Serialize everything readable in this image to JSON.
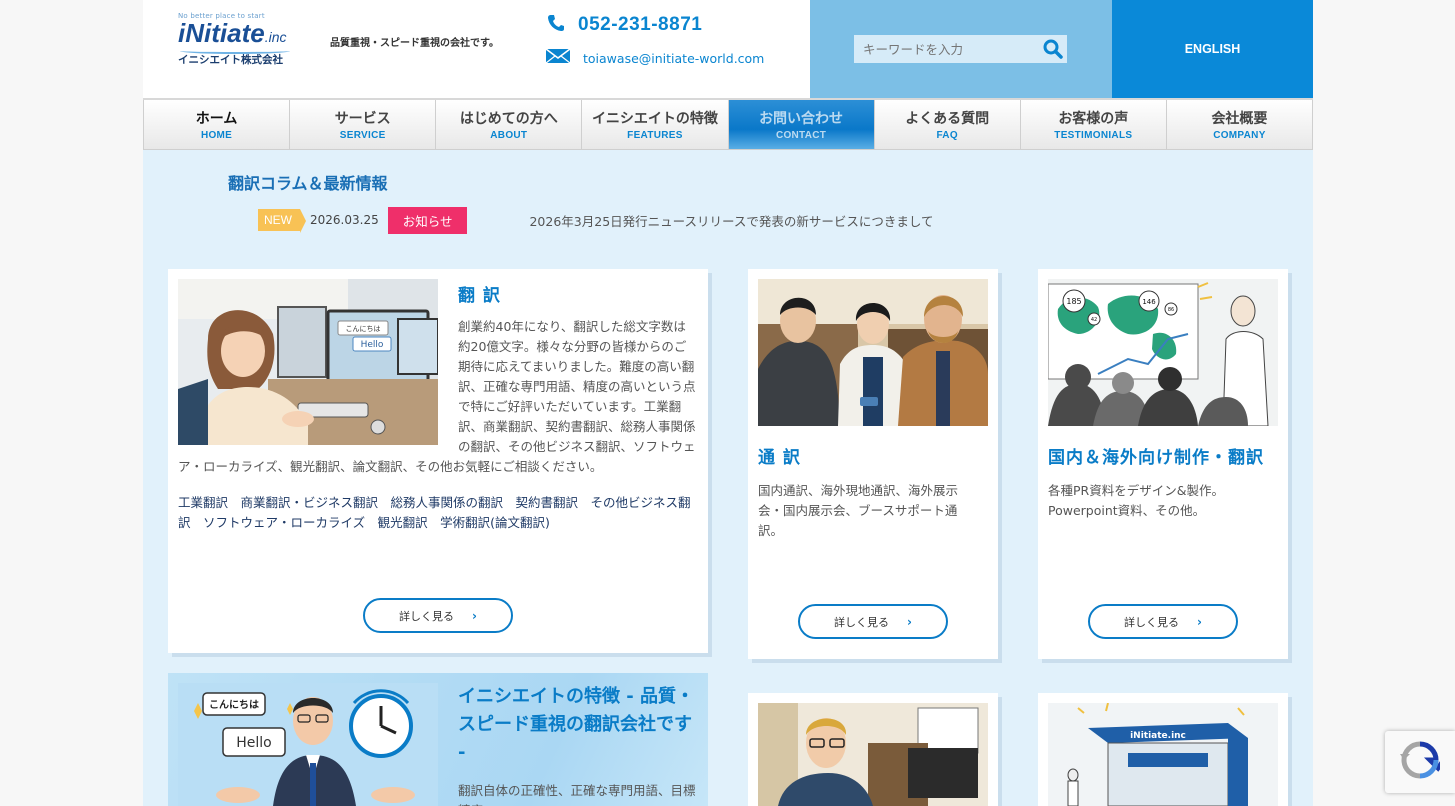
{
  "header": {
    "logo_tagline": "No better place to start",
    "logo_mark": "iNitiate",
    "logo_suffix": ".inc",
    "logo_company": "イニシエイト株式会社",
    "catch": "品質重視・スピード重視の会社です。",
    "phone": "052-231-8871",
    "email": "toiawase@initiate-world.com",
    "search_placeholder": "キーワードを入力",
    "english_label": "ENGLISH"
  },
  "nav": [
    {
      "jp": "ホーム",
      "en": "HOME"
    },
    {
      "jp": "サービス",
      "en": "SERVICE"
    },
    {
      "jp": "はじめての方へ",
      "en": "ABOUT"
    },
    {
      "jp": "イニシエイトの特徴",
      "en": "FEATURES"
    },
    {
      "jp": "お問い合わせ",
      "en": "CONTACT"
    },
    {
      "jp": "よくある質問",
      "en": "FAQ"
    },
    {
      "jp": "お客様の声",
      "en": "TESTIMONIALS"
    },
    {
      "jp": "会社概要",
      "en": "COMPANY"
    }
  ],
  "news": {
    "heading": "翻訳コラム＆最新情報",
    "badge": "NEW",
    "date": "2026.03.25",
    "category": "お知らせ",
    "title": "2026年3月25日発行ニュースリリースで発表の新サービスにつきまして"
  },
  "cards": {
    "translation": {
      "title": "翻 訳",
      "body": "創業約40年になり、翻訳した総文字数は約20億文字。様々な分野の皆様からのご期待に応えてまいりました。難度の高い翻訳、正確な専門用語、精度の高いという点で特にご好評いただいています。工業翻訳、商業翻訳、契約書翻訳、総務人事関係の翻訳、その他ビジネス翻訳、ソフトウェア・ローカライズ、観光翻訳、論文翻訳、その他お気軽にご相談ください。",
      "links": "工業翻訳　商業翻訳・ビジネス翻訳　総務人事関係の翻訳　契約書翻訳　その他ビジネス翻訳　ソフトウェア・ローカライズ　観光翻訳　学術翻訳(論文翻訳)",
      "more": "詳しく見る",
      "bubble1": "こんにちは",
      "bubble2": "Hello"
    },
    "interpretation": {
      "title": "通 訳",
      "body": "国内通訳、海外現地通訳、海外展示会・国内展示会、ブースサポート通訳。",
      "more": "詳しく見る"
    },
    "production": {
      "title": "国内＆海外向け制作・翻訳",
      "body": "各種PR資料をデザイン&製作。Powerpoint資料、その他。",
      "more": "詳しく見る",
      "map_nums": [
        "185",
        "146",
        "42",
        "86"
      ]
    }
  },
  "feature": {
    "title": "イニシエイトの特徴 - 品質・スピード重視の翻訳会社です -",
    "body": "翻訳自体の正確性、正確な専門用語、目標精度",
    "bubble1": "こんにちは",
    "bubble2": "Hello"
  },
  "booth": {
    "sign": "iNitiate.inc"
  }
}
